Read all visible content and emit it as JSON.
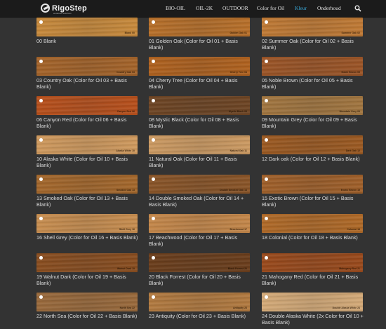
{
  "header": {
    "logo_text": "RigoStep",
    "logo_sub": "woodcare solutions",
    "nav": [
      {
        "label": "BIO-OIL",
        "active": false
      },
      {
        "label": "OIL-2K",
        "active": false
      },
      {
        "label": "OUTDOOR",
        "active": false
      },
      {
        "label": "Color for Oil",
        "active": false
      },
      {
        "label": "Kleur",
        "active": true
      },
      {
        "label": "Onderhoud",
        "active": false
      }
    ],
    "search_icon": "search-icon"
  },
  "swatches": [
    {
      "label": "00 Blank",
      "stamp": "Blank 00",
      "color": "#c88a3c"
    },
    {
      "label": "01 Golden Oak (Color for Oil 01 + Basis Blank)",
      "stamp": "Golden Oak 01",
      "color": "#b8702a"
    },
    {
      "label": "02 Summer Oak (Color for Oil 02 + Basis Blank)",
      "stamp": "Summer Oak 02",
      "color": "#c07a35"
    },
    {
      "label": "03 Country Oak (Color for Oil 03 + Basis Blank)",
      "stamp": "Country Oak 03",
      "color": "#a5642a"
    },
    {
      "label": "04 Cherry Tree (Color for Oil 04 + Basis Blank)",
      "stamp": "Cherry Tree 04",
      "color": "#b0621f"
    },
    {
      "label": "05 Noble Brown (Color for Oil 05 + Basis Blank)",
      "stamp": "Noble Brown 05",
      "color": "#9c5527"
    },
    {
      "label": "06 Canyon Red (Color for Oil 06 + Basis Blank)",
      "stamp": "Canyon Red 06",
      "color": "#b8501c"
    },
    {
      "label": "08 Mystic Black (Color for Oil 08 + Basis Blank)",
      "stamp": "Mystic Black 08",
      "color": "#6e4524"
    },
    {
      "label": "09 Mountain Grey (Color for Oil 09 + Basis Blank)",
      "stamp": "Mountain Grey 09",
      "color": "#a27640"
    },
    {
      "label": "10 Alaska White (Color for Oil 10 + Basis Blank)",
      "stamp": "Alaska White 10",
      "color": "#d09a5e"
    },
    {
      "label": "11 Natural Oak (Color for Oil 11 + Basis Blank)",
      "stamp": "Natural Oak 11",
      "color": "#cc9a62"
    },
    {
      "label": "12 Dark oak (Color for Oil 12 + Basis Blank)",
      "stamp": "Dark Oak 12",
      "color": "#9c5a22"
    },
    {
      "label": "13 Smoked Oak (Color for Oil 13 + Basis Blank)",
      "stamp": "Smoked Oak 13",
      "color": "#a5682c"
    },
    {
      "label": "14 Double Smoked Oak (Color for Oil 14 + Basis Blank)",
      "stamp": "Double Smoked Oak 14",
      "color": "#8a5528"
    },
    {
      "label": "15 Exotic Brown (Color for Oil 15 + Basis Blank)",
      "stamp": "Exotic Brown 15",
      "color": "#a0602a"
    },
    {
      "label": "16 Shell Grey (Color for Oil 16 + Basis Blank)",
      "stamp": "Shell Grey 16",
      "color": "#c88e50"
    },
    {
      "label": "17 Beachwood (Color for Oil 17 + Basis Blank)",
      "stamp": "Beachwood 17",
      "color": "#c4874a"
    },
    {
      "label": "18 Colonial (Color for Oil 18 + Basis Blank)",
      "stamp": "Colonial 18",
      "color": "#b06a28"
    },
    {
      "label": "19 Walnut Dark (Color for Oil 19 + Basis Blank)",
      "stamp": "Walnut Dark 19",
      "color": "#8a4e20"
    },
    {
      "label": "20 Black Forrest (Color for Oil 20 + Basis Blank)",
      "stamp": "Black Forrest 20",
      "color": "#6b3e1c"
    },
    {
      "label": "21 Mahogany Red (Color for Oil 21 + Basis Blank)",
      "stamp": "Mahogany Red 21",
      "color": "#9a4a1c"
    },
    {
      "label": "22 North Sea (Color for Oil 22 + Basis Blank)",
      "stamp": "North Sea 22",
      "color": "#9a6a3c"
    },
    {
      "label": "23 Antiquity (Color for Oil 23 + Basis Blank)",
      "stamp": "Antiquity 23",
      "color": "#b27a40"
    },
    {
      "label": "24 Double Alaska White (2x Color for Oil 10 + Basis Blank)",
      "stamp": "Double Alaska White 24",
      "color": "#d4aa78"
    }
  ]
}
